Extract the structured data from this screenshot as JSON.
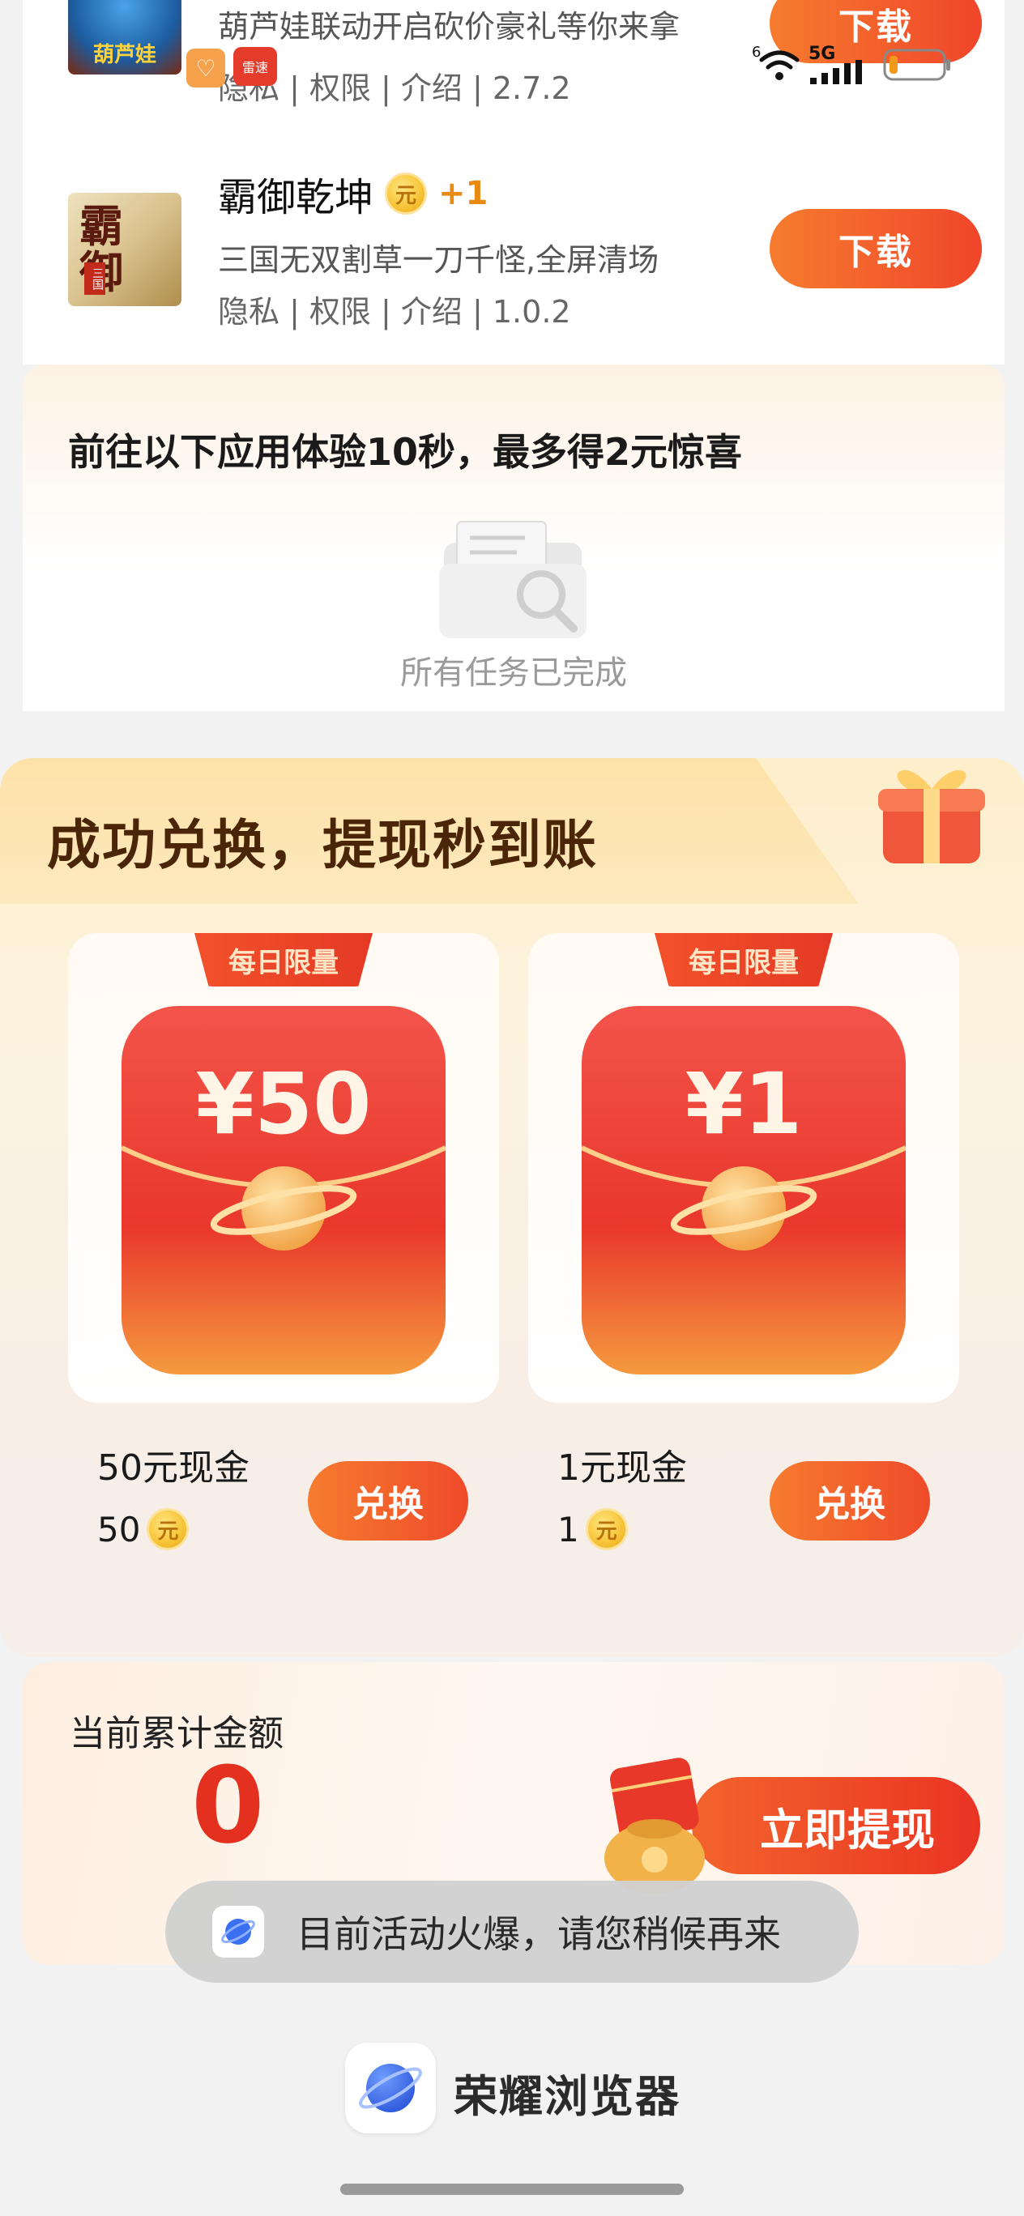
{
  "status_bar": {
    "notif_badge_1": "♡",
    "notif_badge_2": "雷速",
    "network": "5G",
    "sim_slot": "6"
  },
  "apps": [
    {
      "icon_text": "葫芦娃",
      "desc": "葫芦娃联动开启砍价豪礼等你来拿",
      "meta": "隐私 | 权限 | 介绍 | 2.7.2",
      "button": "下载"
    },
    {
      "title": "霸御乾坤",
      "coin_label": "元",
      "reward": "+1",
      "icon_text": "霸御",
      "icon_sub": "三国",
      "desc": "三国无双割草一刀千怪,全屏清场",
      "meta": "隐私 | 权限 | 介绍 | 1.0.2",
      "button": "下载"
    }
  ],
  "task": {
    "heading": "前往以下应用体验10秒，最多得2元惊喜",
    "empty_text": "所有任务已完成"
  },
  "exchange": {
    "title": "成功兑换，提现秒到账",
    "prizes": [
      {
        "tag": "每日限量",
        "amount": "¥50",
        "name": "50元现金",
        "cost": "50",
        "coin_label": "元",
        "button": "兑换"
      },
      {
        "tag": "每日限量",
        "amount": "¥1",
        "name": "1元现金",
        "cost": "1",
        "coin_label": "元",
        "button": "兑换"
      }
    ]
  },
  "balance": {
    "label": "当前累计金额",
    "value": "0",
    "button": "立即提现"
  },
  "toast": {
    "text": "目前活动火爆，请您稍候再来",
    "icon": "browser-planet-icon"
  },
  "footer": {
    "brand_name": "荣耀浏览器",
    "icon": "browser-planet-icon"
  },
  "colors": {
    "accent_orange": "#f67c2f",
    "accent_red": "#e3301f",
    "coin_gold": "#f7c336"
  }
}
